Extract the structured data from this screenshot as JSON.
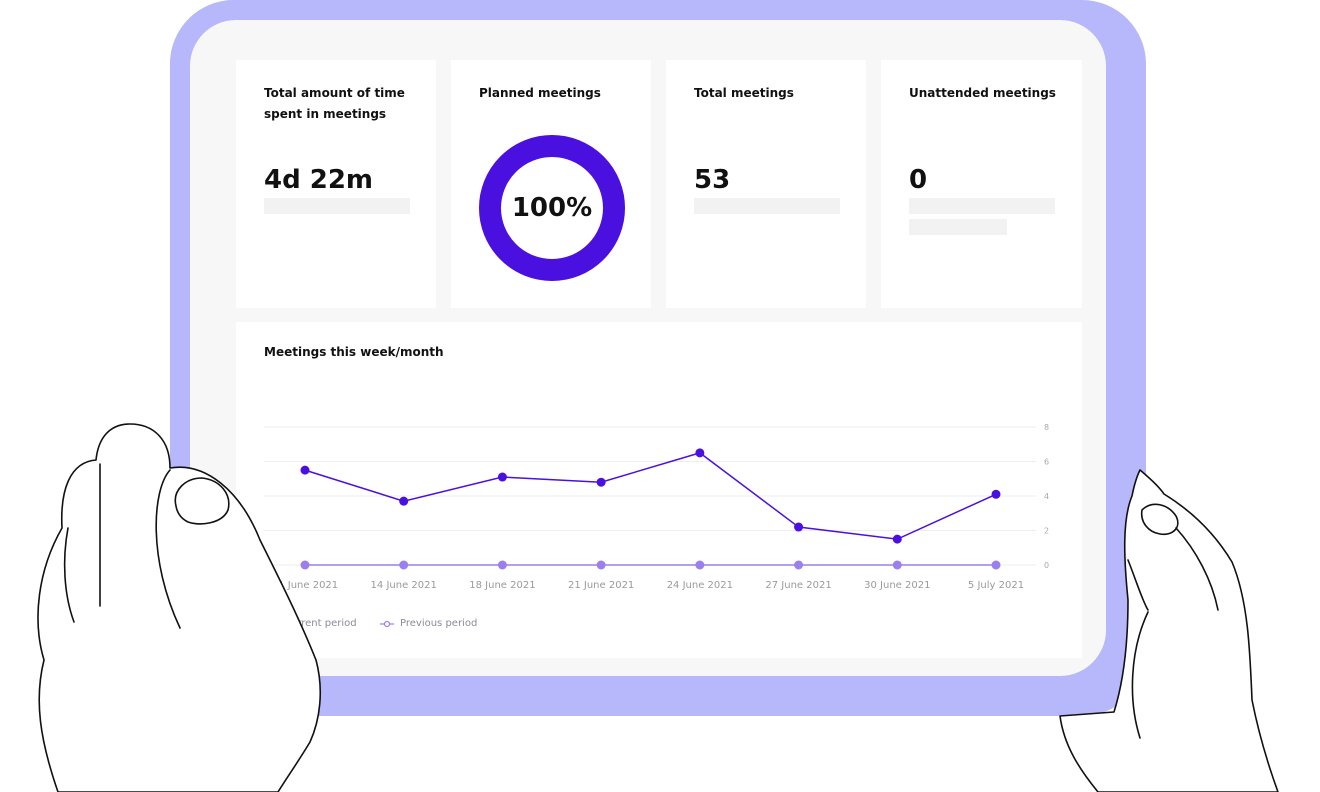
{
  "cards": {
    "time": {
      "title": "Total amount of time spent in meetings",
      "value": "4d 22m"
    },
    "planned": {
      "title": "Planned meetings",
      "value": "100%",
      "percent": 100
    },
    "total": {
      "title": "Total meetings",
      "value": "53"
    },
    "unattended": {
      "title": "Unattended meetings",
      "value": "0"
    }
  },
  "chart": {
    "title": "Meetings this week/month",
    "legend": {
      "current": "Current period",
      "previous": "Previous period"
    }
  },
  "colors": {
    "accent": "#4a10e0",
    "previous": "#9b7ff0",
    "frame": "#b6b8fb"
  },
  "chart_data": {
    "type": "line",
    "title": "Meetings this week/month",
    "x": [
      "11 June 2021",
      "14 June 2021",
      "18 June 2021",
      "21 June 2021",
      "24 June 2021",
      "27 June 2021",
      "30 June 2021",
      "5 July 2021"
    ],
    "yticks": [
      0,
      2,
      4,
      6,
      8
    ],
    "ylim": [
      0,
      8
    ],
    "series": [
      {
        "name": "Current period",
        "values": [
          5.5,
          3.7,
          5.1,
          4.8,
          6.5,
          2.2,
          1.5,
          4.1
        ]
      },
      {
        "name": "Previous period",
        "values": [
          0,
          0,
          0,
          0,
          0,
          0,
          0,
          0
        ]
      }
    ],
    "grid": true,
    "legend_position": "bottom-left"
  }
}
